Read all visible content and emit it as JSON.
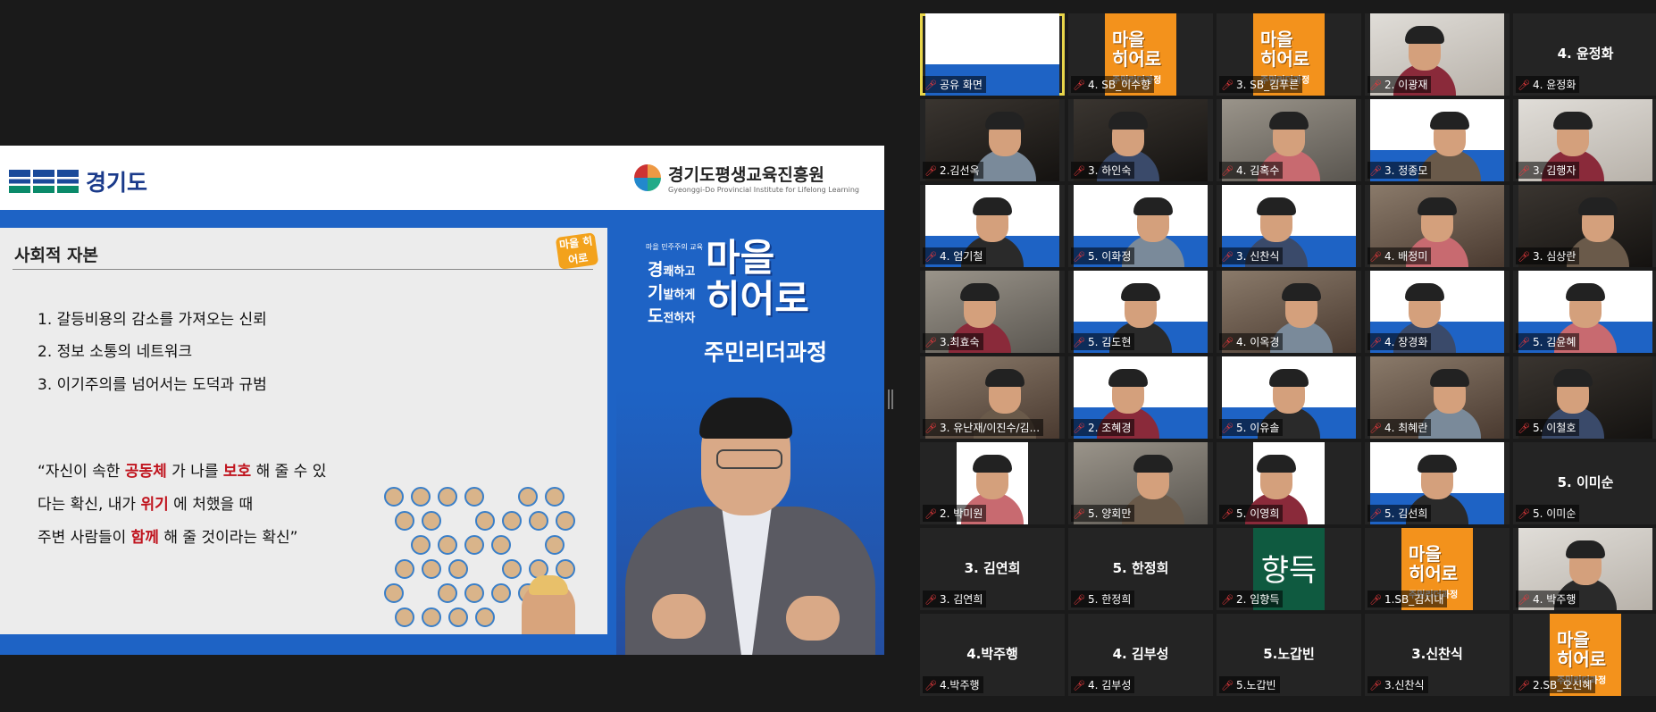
{
  "share": {
    "brand": "경기도",
    "institute": {
      "name_kr": "경기도평생교육진흥원",
      "name_en": "Gyeonggi-Do Provincial Institute for Lifelong Learning"
    },
    "slide": {
      "title": "사회적 자본",
      "badge": "마을 히어로",
      "points": [
        "1. 갈등비용의 감소를 가져오는 신뢰",
        "2. 정보 소통의 네트워크",
        "3. 이기주의를 넘어서는 도덕과 규범"
      ],
      "quote": [
        [
          {
            "t": "“자신이 속한 "
          },
          {
            "t": "공동체",
            "red": true
          },
          {
            "t": " 가 나를 "
          },
          {
            "t": "보호",
            "red": true
          },
          {
            "t": " 해 줄 수 있"
          }
        ],
        [
          {
            "t": "다는 확신, 내가 "
          },
          {
            "t": "위기",
            "red": true
          },
          {
            "t": " 에 처했을 때"
          }
        ],
        [
          {
            "t": "주변 사람들이 "
          },
          {
            "t": "함께",
            "red": true
          },
          {
            "t": "  해 줄 것이라는 확신”"
          }
        ]
      ]
    },
    "banner": {
      "small": "마을 민주주의 교육",
      "lines": [
        {
          "big": "경",
          "rest": "쾌하고"
        },
        {
          "big": "기",
          "rest": "발하게"
        },
        {
          "big": "도",
          "rest": "전하자"
        }
      ],
      "hero1": "마을",
      "hero2": "히어로",
      "course": "주민리더과정"
    }
  },
  "tiles": [
    {
      "label": "공유 화면",
      "kind": "screen",
      "active": true
    },
    {
      "label": "4. SB_이수향",
      "kind": "orange"
    },
    {
      "label": "3. SB_김푸른",
      "kind": "orange"
    },
    {
      "label": "2. 이광재",
      "kind": "light"
    },
    {
      "label": "4. 윤정화",
      "name": "4. 윤정화",
      "kind": "none"
    },
    {
      "label": "2.김선옥",
      "kind": "dark"
    },
    {
      "label": "3. 하인숙",
      "kind": "dark"
    },
    {
      "label": "4. 김혹수",
      "kind": "gray"
    },
    {
      "label": "3. 정종모",
      "kind": "blue"
    },
    {
      "label": "3. 김행자",
      "kind": "light"
    },
    {
      "label": "4. 엄기철",
      "kind": "blue"
    },
    {
      "label": "5. 이화정",
      "kind": "blue"
    },
    {
      "label": "3. 신찬식",
      "kind": "blue"
    },
    {
      "label": "4. 배정미",
      "kind": "room"
    },
    {
      "label": "3. 심상란",
      "kind": "dark"
    },
    {
      "label": "3.최효숙",
      "kind": "gray"
    },
    {
      "label": "5. 김도현",
      "kind": "blue"
    },
    {
      "label": "4. 이옥경",
      "kind": "room"
    },
    {
      "label": "4. 장경화",
      "kind": "blue"
    },
    {
      "label": "5. 김윤혜",
      "kind": "blue"
    },
    {
      "label": "3. 유난재/이진수/김...",
      "kind": "room"
    },
    {
      "label": "2. 조혜경",
      "kind": "blue"
    },
    {
      "label": "5. 이유솔",
      "kind": "blue"
    },
    {
      "label": "4. 최혜란",
      "kind": "room"
    },
    {
      "label": "5. 이철호",
      "kind": "dark"
    },
    {
      "label": "2. 박미원",
      "kind": "white"
    },
    {
      "label": "5. 양회만",
      "kind": "gray"
    },
    {
      "label": "5. 이영희",
      "kind": "white"
    },
    {
      "label": "5. 김선희",
      "kind": "blue"
    },
    {
      "label": "5. 이미순",
      "name": "5. 이미순",
      "kind": "none"
    },
    {
      "label": "3. 김연희",
      "name": "3. 김연희",
      "kind": "none"
    },
    {
      "label": "5. 한정희",
      "name": "5. 한정희",
      "kind": "none"
    },
    {
      "label": "2. 임향득",
      "kind": "green",
      "text": "향득"
    },
    {
      "label": "1.SB_김시내",
      "kind": "orange"
    },
    {
      "label": "4. 박주행",
      "kind": "light"
    },
    {
      "label": "4.박주행",
      "name": "4.박주행",
      "kind": "none"
    },
    {
      "label": "4. 김부성",
      "name": "4. 김부성",
      "kind": "none"
    },
    {
      "label": "5.노갑빈",
      "name": "5.노갑빈",
      "kind": "none"
    },
    {
      "label": "3.신찬식",
      "name": "3.신찬식",
      "kind": "none"
    },
    {
      "label": "2.SB_오신혜",
      "kind": "orange"
    }
  ],
  "icons": {
    "muted_mic": "muted-mic-icon"
  },
  "colors": {
    "accent_blue": "#1e63c5",
    "brand_orange": "#f3921c",
    "active_border": "#e8d54a",
    "muted_red": "#e5393c",
    "keyword_red": "#c0141e"
  }
}
